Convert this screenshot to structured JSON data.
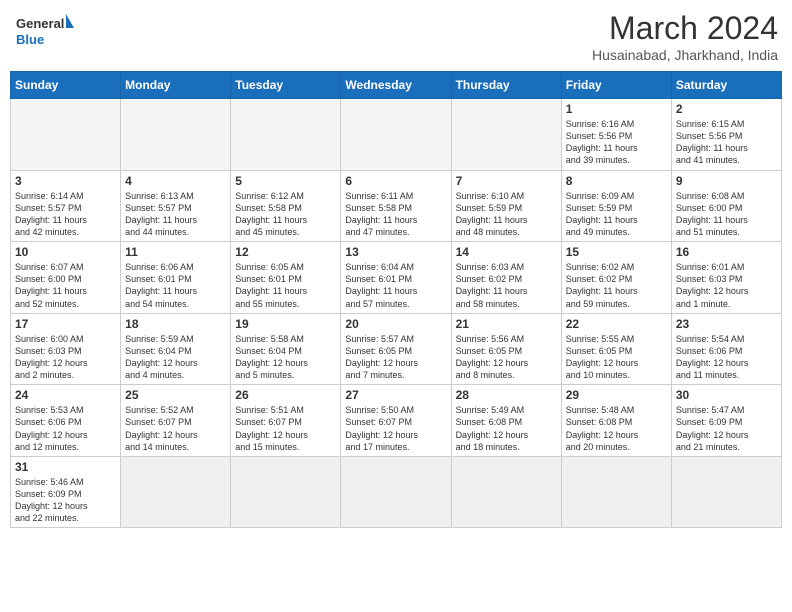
{
  "header": {
    "logo_text_normal": "General",
    "logo_text_blue": "Blue",
    "month_year": "March 2024",
    "location": "Husainabad, Jharkhand, India"
  },
  "weekdays": [
    "Sunday",
    "Monday",
    "Tuesday",
    "Wednesday",
    "Thursday",
    "Friday",
    "Saturday"
  ],
  "weeks": [
    [
      {
        "day": "",
        "info": ""
      },
      {
        "day": "",
        "info": ""
      },
      {
        "day": "",
        "info": ""
      },
      {
        "day": "",
        "info": ""
      },
      {
        "day": "",
        "info": ""
      },
      {
        "day": "1",
        "info": "Sunrise: 6:16 AM\nSunset: 5:56 PM\nDaylight: 11 hours\nand 39 minutes."
      },
      {
        "day": "2",
        "info": "Sunrise: 6:15 AM\nSunset: 5:56 PM\nDaylight: 11 hours\nand 41 minutes."
      }
    ],
    [
      {
        "day": "3",
        "info": "Sunrise: 6:14 AM\nSunset: 5:57 PM\nDaylight: 11 hours\nand 42 minutes."
      },
      {
        "day": "4",
        "info": "Sunrise: 6:13 AM\nSunset: 5:57 PM\nDaylight: 11 hours\nand 44 minutes."
      },
      {
        "day": "5",
        "info": "Sunrise: 6:12 AM\nSunset: 5:58 PM\nDaylight: 11 hours\nand 45 minutes."
      },
      {
        "day": "6",
        "info": "Sunrise: 6:11 AM\nSunset: 5:58 PM\nDaylight: 11 hours\nand 47 minutes."
      },
      {
        "day": "7",
        "info": "Sunrise: 6:10 AM\nSunset: 5:59 PM\nDaylight: 11 hours\nand 48 minutes."
      },
      {
        "day": "8",
        "info": "Sunrise: 6:09 AM\nSunset: 5:59 PM\nDaylight: 11 hours\nand 49 minutes."
      },
      {
        "day": "9",
        "info": "Sunrise: 6:08 AM\nSunset: 6:00 PM\nDaylight: 11 hours\nand 51 minutes."
      }
    ],
    [
      {
        "day": "10",
        "info": "Sunrise: 6:07 AM\nSunset: 6:00 PM\nDaylight: 11 hours\nand 52 minutes."
      },
      {
        "day": "11",
        "info": "Sunrise: 6:06 AM\nSunset: 6:01 PM\nDaylight: 11 hours\nand 54 minutes."
      },
      {
        "day": "12",
        "info": "Sunrise: 6:05 AM\nSunset: 6:01 PM\nDaylight: 11 hours\nand 55 minutes."
      },
      {
        "day": "13",
        "info": "Sunrise: 6:04 AM\nSunset: 6:01 PM\nDaylight: 11 hours\nand 57 minutes."
      },
      {
        "day": "14",
        "info": "Sunrise: 6:03 AM\nSunset: 6:02 PM\nDaylight: 11 hours\nand 58 minutes."
      },
      {
        "day": "15",
        "info": "Sunrise: 6:02 AM\nSunset: 6:02 PM\nDaylight: 11 hours\nand 59 minutes."
      },
      {
        "day": "16",
        "info": "Sunrise: 6:01 AM\nSunset: 6:03 PM\nDaylight: 12 hours\nand 1 minute."
      }
    ],
    [
      {
        "day": "17",
        "info": "Sunrise: 6:00 AM\nSunset: 6:03 PM\nDaylight: 12 hours\nand 2 minutes."
      },
      {
        "day": "18",
        "info": "Sunrise: 5:59 AM\nSunset: 6:04 PM\nDaylight: 12 hours\nand 4 minutes."
      },
      {
        "day": "19",
        "info": "Sunrise: 5:58 AM\nSunset: 6:04 PM\nDaylight: 12 hours\nand 5 minutes."
      },
      {
        "day": "20",
        "info": "Sunrise: 5:57 AM\nSunset: 6:05 PM\nDaylight: 12 hours\nand 7 minutes."
      },
      {
        "day": "21",
        "info": "Sunrise: 5:56 AM\nSunset: 6:05 PM\nDaylight: 12 hours\nand 8 minutes."
      },
      {
        "day": "22",
        "info": "Sunrise: 5:55 AM\nSunset: 6:05 PM\nDaylight: 12 hours\nand 10 minutes."
      },
      {
        "day": "23",
        "info": "Sunrise: 5:54 AM\nSunset: 6:06 PM\nDaylight: 12 hours\nand 11 minutes."
      }
    ],
    [
      {
        "day": "24",
        "info": "Sunrise: 5:53 AM\nSunset: 6:06 PM\nDaylight: 12 hours\nand 12 minutes."
      },
      {
        "day": "25",
        "info": "Sunrise: 5:52 AM\nSunset: 6:07 PM\nDaylight: 12 hours\nand 14 minutes."
      },
      {
        "day": "26",
        "info": "Sunrise: 5:51 AM\nSunset: 6:07 PM\nDaylight: 12 hours\nand 15 minutes."
      },
      {
        "day": "27",
        "info": "Sunrise: 5:50 AM\nSunset: 6:07 PM\nDaylight: 12 hours\nand 17 minutes."
      },
      {
        "day": "28",
        "info": "Sunrise: 5:49 AM\nSunset: 6:08 PM\nDaylight: 12 hours\nand 18 minutes."
      },
      {
        "day": "29",
        "info": "Sunrise: 5:48 AM\nSunset: 6:08 PM\nDaylight: 12 hours\nand 20 minutes."
      },
      {
        "day": "30",
        "info": "Sunrise: 5:47 AM\nSunset: 6:09 PM\nDaylight: 12 hours\nand 21 minutes."
      }
    ],
    [
      {
        "day": "31",
        "info": "Sunrise: 5:46 AM\nSunset: 6:09 PM\nDaylight: 12 hours\nand 22 minutes."
      },
      {
        "day": "",
        "info": ""
      },
      {
        "day": "",
        "info": ""
      },
      {
        "day": "",
        "info": ""
      },
      {
        "day": "",
        "info": ""
      },
      {
        "day": "",
        "info": ""
      },
      {
        "day": "",
        "info": ""
      }
    ]
  ]
}
